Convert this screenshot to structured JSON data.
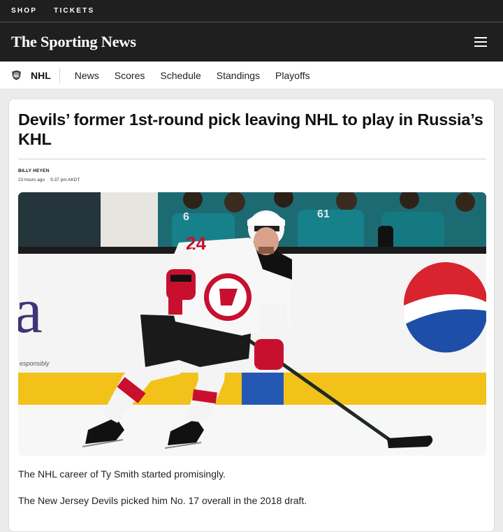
{
  "topbar": {
    "links": [
      "SHOP",
      "TICKETS"
    ]
  },
  "brand": {
    "name": "The Sporting News"
  },
  "subnav": {
    "league": "NHL",
    "links": [
      "News",
      "Scores",
      "Schedule",
      "Standings",
      "Playoffs"
    ]
  },
  "article": {
    "headline": "Devils’ former 1st-round pick leaving NHL to play in Russia’s KHL",
    "author": "BILLY HEYEN",
    "time_ago": "23 hours ago",
    "time_stamp": "5:37 pm AKDT",
    "paragraphs": [
      "The NHL career of Ty Smith started promisingly.",
      "The New Jersey Devils picked him No. 17 overall in the 2018 draft."
    ]
  },
  "image": {
    "jersey_number": "24",
    "board_letter": "a",
    "board_text": "esponsibly",
    "glass_numbers": [
      "6",
      "61"
    ]
  },
  "colors": {
    "header_bg": "#1f1f1f",
    "devils_red": "#c8102e",
    "teal": "#1c6b73",
    "pepsi_blue": "#1d4fa8",
    "board_yellow": "#f2c21b"
  }
}
